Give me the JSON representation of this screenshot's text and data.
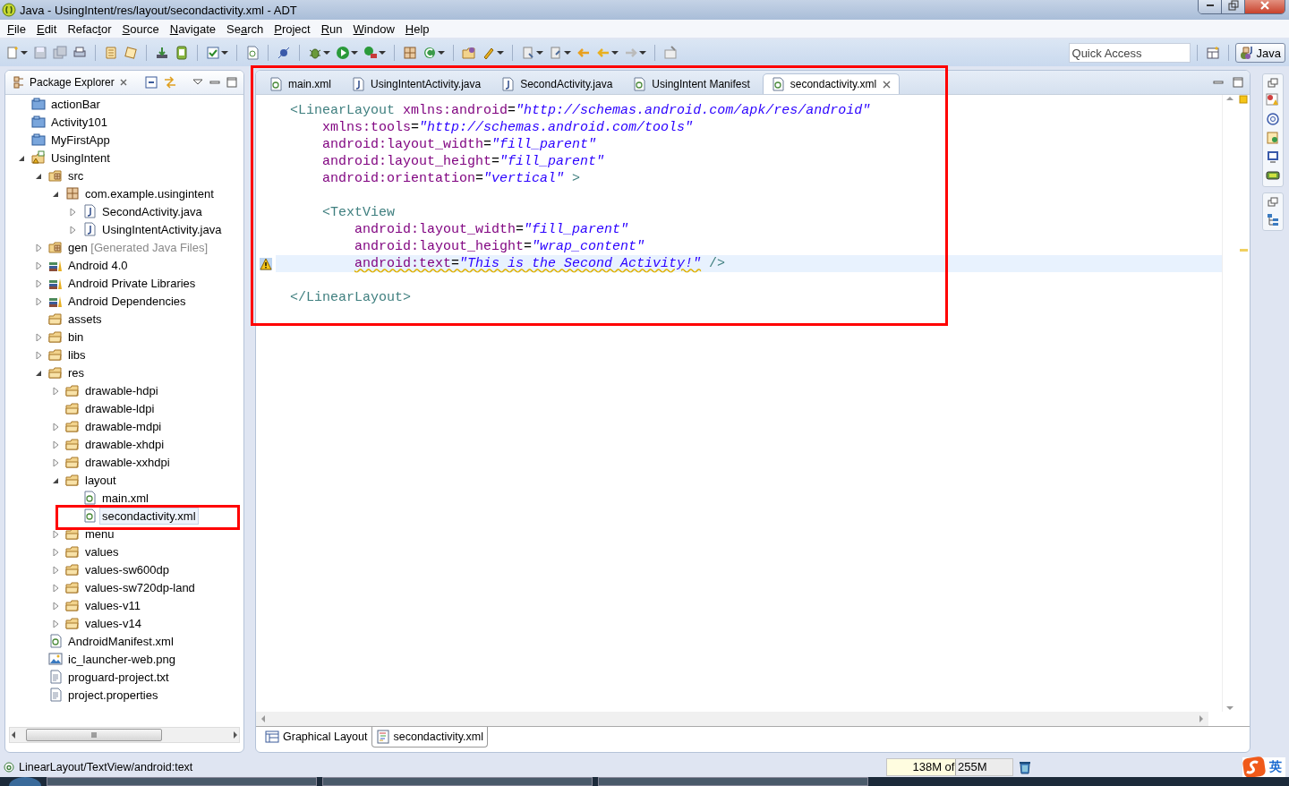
{
  "window": {
    "title": "Java - UsingIntent/res/layout/secondactivity.xml - ADT"
  },
  "menu": [
    {
      "key": "F",
      "post": "ile"
    },
    {
      "key": "E",
      "post": "dit"
    },
    {
      "pre": "Refac",
      "key": "t",
      "post": "or"
    },
    {
      "key": "S",
      "post": "ource"
    },
    {
      "key": "N",
      "post": "avigate"
    },
    {
      "pre": "Se",
      "key": "a",
      "post": "rch"
    },
    {
      "key": "P",
      "post": "roject"
    },
    {
      "key": "R",
      "post": "un"
    },
    {
      "key": "W",
      "post": "indow"
    },
    {
      "key": "H",
      "post": "elp"
    }
  ],
  "quick_access": {
    "placeholder": "Quick Access"
  },
  "perspective": {
    "label": "Java",
    "selected": true
  },
  "explorer": {
    "title": "Package Explorer",
    "tree": [
      {
        "label": "actionBar",
        "kind": "closed-project",
        "expandable": false,
        "selected": false
      },
      {
        "label": "Activity101",
        "kind": "closed-project",
        "expandable": false,
        "selected": false
      },
      {
        "label": "MyFirstApp",
        "kind": "closed-project",
        "expandable": false,
        "selected": false
      },
      {
        "label": "UsingIntent",
        "kind": "project",
        "expandable": true,
        "expanded": true,
        "selected": false,
        "children": [
          {
            "label": "src",
            "kind": "source-folder",
            "expandable": true,
            "expanded": true,
            "selected": false,
            "children": [
              {
                "label": "com.example.usingintent",
                "kind": "package",
                "expandable": true,
                "expanded": true,
                "selected": false,
                "children": [
                  {
                    "label": "SecondActivity.java",
                    "kind": "java",
                    "expandable": true,
                    "expanded": false,
                    "selected": false
                  },
                  {
                    "label": "UsingIntentActivity.java",
                    "kind": "java",
                    "expandable": true,
                    "expanded": false,
                    "selected": false
                  }
                ]
              }
            ]
          },
          {
            "label": "gen",
            "decoration": "[Generated Java Files]",
            "kind": "source-folder",
            "expandable": true,
            "expanded": false,
            "selected": false
          },
          {
            "label": "Android 4.0",
            "kind": "library",
            "expandable": true,
            "expanded": false,
            "selected": false
          },
          {
            "label": "Android Private Libraries",
            "kind": "library",
            "expandable": true,
            "expanded": false,
            "selected": false
          },
          {
            "label": "Android Dependencies",
            "kind": "library",
            "expandable": true,
            "expanded": false,
            "selected": false
          },
          {
            "label": "assets",
            "kind": "folder",
            "expandable": false,
            "selected": false
          },
          {
            "label": "bin",
            "kind": "folder",
            "expandable": true,
            "expanded": false,
            "selected": false
          },
          {
            "label": "libs",
            "kind": "folder",
            "expandable": true,
            "expanded": false,
            "selected": false
          },
          {
            "label": "res",
            "kind": "folder",
            "expandable": true,
            "expanded": true,
            "selected": false,
            "children": [
              {
                "label": "drawable-hdpi",
                "kind": "folder",
                "expandable": true,
                "expanded": false,
                "selected": false
              },
              {
                "label": "drawable-ldpi",
                "kind": "folder",
                "expandable": false,
                "selected": false
              },
              {
                "label": "drawable-mdpi",
                "kind": "folder",
                "expandable": true,
                "expanded": false,
                "selected": false
              },
              {
                "label": "drawable-xhdpi",
                "kind": "folder",
                "expandable": true,
                "expanded": false,
                "selected": false
              },
              {
                "label": "drawable-xxhdpi",
                "kind": "folder",
                "expandable": true,
                "expanded": false,
                "selected": false
              },
              {
                "label": "layout",
                "kind": "folder",
                "expandable": true,
                "expanded": true,
                "selected": false,
                "children": [
                  {
                    "label": "main.xml",
                    "kind": "xml",
                    "expandable": false,
                    "selected": false
                  },
                  {
                    "label": "secondactivity.xml",
                    "kind": "xml",
                    "expandable": false,
                    "selected": true
                  }
                ]
              },
              {
                "label": "menu",
                "kind": "folder",
                "expandable": true,
                "expanded": false,
                "selected": false
              },
              {
                "label": "values",
                "kind": "folder",
                "expandable": true,
                "expanded": false,
                "selected": false
              },
              {
                "label": "values-sw600dp",
                "kind": "folder",
                "expandable": true,
                "expanded": false,
                "selected": false
              },
              {
                "label": "values-sw720dp-land",
                "kind": "folder",
                "expandable": true,
                "expanded": false,
                "selected": false
              },
              {
                "label": "values-v11",
                "kind": "folder",
                "expandable": true,
                "expanded": false,
                "selected": false
              },
              {
                "label": "values-v14",
                "kind": "folder",
                "expandable": true,
                "expanded": false,
                "selected": false
              }
            ]
          },
          {
            "label": "AndroidManifest.xml",
            "kind": "xml",
            "expandable": false,
            "selected": false
          },
          {
            "label": "ic_launcher-web.png",
            "kind": "image",
            "expandable": false,
            "selected": false
          },
          {
            "label": "proguard-project.txt",
            "kind": "text",
            "expandable": false,
            "selected": false
          },
          {
            "label": "project.properties",
            "kind": "text",
            "expandable": false,
            "selected": false
          }
        ]
      }
    ]
  },
  "editor": {
    "tabs": [
      {
        "label": "main.xml",
        "kind": "xml",
        "selected": false
      },
      {
        "label": "UsingIntentActivity.java",
        "kind": "java",
        "selected": false
      },
      {
        "label": "SecondActivity.java",
        "kind": "java",
        "selected": false
      },
      {
        "label": "UsingIntent Manifest",
        "kind": "xml",
        "selected": false
      },
      {
        "label": "secondactivity.xml",
        "kind": "xml",
        "selected": true
      }
    ],
    "lines": [
      {
        "kind": "open-tag",
        "current": false,
        "warning": false,
        "tokens": [
          {
            "kind": "tag",
            "text": "<LinearLayout"
          },
          {
            "kind": "attr",
            "text": "xmlns:android"
          },
          {
            "kind": "op",
            "text": "="
          },
          {
            "kind": "value",
            "text": "\"http://schemas.android.com/apk/res/android\""
          }
        ]
      },
      {
        "kind": "tag-attr",
        "current": false,
        "warning": false,
        "tokens": [
          {
            "kind": "attr",
            "text": "xmlns:tools"
          },
          {
            "kind": "op",
            "text": "="
          },
          {
            "kind": "value",
            "text": "\"http://schemas.android.com/tools\""
          }
        ]
      },
      {
        "kind": "tag-attr",
        "current": false,
        "warning": false,
        "tokens": [
          {
            "kind": "attr",
            "text": "android:layout_width"
          },
          {
            "kind": "op",
            "text": "="
          },
          {
            "kind": "value",
            "text": "\"fill_parent\""
          }
        ]
      },
      {
        "kind": "tag-attr",
        "current": false,
        "warning": false,
        "tokens": [
          {
            "kind": "attr",
            "text": "android:layout_height"
          },
          {
            "kind": "op",
            "text": "="
          },
          {
            "kind": "value",
            "text": "\"fill_parent\""
          }
        ]
      },
      {
        "kind": "tag-attr",
        "current": false,
        "warning": false,
        "tokens": [
          {
            "kind": "attr",
            "text": "android:orientation"
          },
          {
            "kind": "op",
            "text": "="
          },
          {
            "kind": "value",
            "text": "\"vertical\""
          },
          {
            "kind": "end",
            "text": ">"
          }
        ]
      },
      {
        "kind": "blank",
        "current": false,
        "warning": false
      },
      {
        "kind": "child-tag",
        "current": false,
        "warning": false,
        "tokens": [
          {
            "kind": "tag",
            "text": "<TextView"
          }
        ]
      },
      {
        "kind": "child-attr",
        "current": false,
        "warning": false,
        "tokens": [
          {
            "kind": "attr",
            "text": "android:layout_width"
          },
          {
            "kind": "op",
            "text": "="
          },
          {
            "kind": "value",
            "text": "\"fill_parent\""
          }
        ]
      },
      {
        "kind": "child-attr",
        "current": false,
        "warning": false,
        "tokens": [
          {
            "kind": "attr",
            "text": "android:layout_height"
          },
          {
            "kind": "op",
            "text": "="
          },
          {
            "kind": "value",
            "text": "\"wrap_content\""
          }
        ]
      },
      {
        "kind": "child-attr",
        "current": true,
        "warning": true,
        "tokens": [
          {
            "kind": "attr",
            "text": "android:text"
          },
          {
            "kind": "op",
            "text": "="
          },
          {
            "kind": "value",
            "text": "\"This is the Second Activity!\""
          },
          {
            "kind": "end",
            "text": "/>"
          }
        ]
      },
      {
        "kind": "blank",
        "current": false,
        "warning": false
      },
      {
        "kind": "open-tag",
        "current": false,
        "warning": false,
        "tokens": [
          {
            "kind": "tag",
            "text": "</LinearLayout>"
          }
        ]
      }
    ],
    "bottom_tabs": [
      {
        "label": "Graphical Layout",
        "kind": "layout",
        "selected": false
      },
      {
        "label": "secondactivity.xml",
        "kind": "source",
        "selected": true
      }
    ]
  },
  "status": {
    "path": "LinearLayout/TextView/android:text",
    "heap": {
      "reading": "138M of 255M",
      "level": 0.54
    }
  },
  "ime": {
    "mode": "英"
  }
}
